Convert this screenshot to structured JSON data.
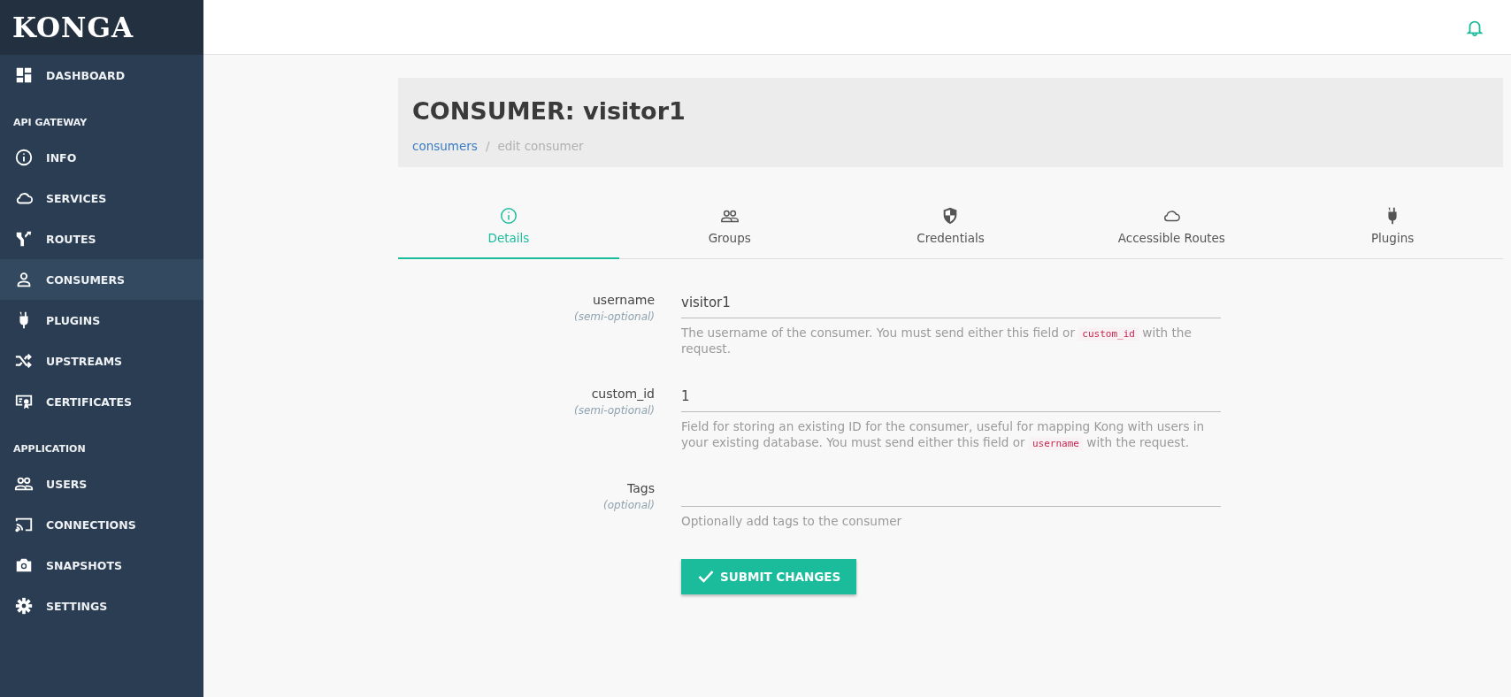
{
  "sidebar": {
    "logo": "KONGA",
    "items": [
      {
        "kind": "item",
        "label": "DASHBOARD",
        "selected": false
      },
      {
        "kind": "section",
        "label": "API GATEWAY"
      },
      {
        "kind": "item",
        "label": "INFO",
        "selected": false
      },
      {
        "kind": "item",
        "label": "SERVICES",
        "selected": false
      },
      {
        "kind": "item",
        "label": "ROUTES",
        "selected": false
      },
      {
        "kind": "item",
        "label": "CONSUMERS",
        "selected": true
      },
      {
        "kind": "item",
        "label": "PLUGINS",
        "selected": false
      },
      {
        "kind": "item",
        "label": "UPSTREAMS",
        "selected": false
      },
      {
        "kind": "item",
        "label": "CERTIFICATES",
        "selected": false
      },
      {
        "kind": "section",
        "label": "APPLICATION"
      },
      {
        "kind": "item",
        "label": "USERS",
        "selected": false
      },
      {
        "kind": "item",
        "label": "CONNECTIONS",
        "selected": false
      },
      {
        "kind": "item",
        "label": "SNAPSHOTS",
        "selected": false
      },
      {
        "kind": "item",
        "label": "SETTINGS",
        "selected": false
      }
    ]
  },
  "page": {
    "title": "CONSUMER: visitor1",
    "breadcrumb": [
      {
        "label": "consumers",
        "kind": "link"
      },
      {
        "label": "/",
        "kind": "separator"
      },
      {
        "label": "edit consumer",
        "kind": "current"
      }
    ]
  },
  "tabs": [
    {
      "label": "Details",
      "selected": true
    },
    {
      "label": "Groups",
      "selected": false
    },
    {
      "label": "Credentials",
      "selected": false
    },
    {
      "label": "Accessible Routes",
      "selected": false
    },
    {
      "label": "Plugins",
      "selected": false
    }
  ],
  "form": {
    "fields": [
      {
        "label": "username",
        "note": "(semi-optional)",
        "value": "visitor1",
        "help": [
          {
            "kind": "text",
            "text": "The username of the consumer. You must send either this field or "
          },
          {
            "kind": "code",
            "text": "custom_id"
          },
          {
            "kind": "text",
            "text": " with the request."
          }
        ]
      },
      {
        "label": "custom_id",
        "note": "(semi-optional)",
        "value": "1",
        "help": [
          {
            "kind": "text",
            "text": "Field for storing an existing ID for the consumer, useful for mapping Kong with users in your existing database. You must send either this field or "
          },
          {
            "kind": "code",
            "text": "username"
          },
          {
            "kind": "text",
            "text": " with the request."
          }
        ]
      },
      {
        "label": "Tags",
        "note": "(optional)",
        "help": [
          {
            "kind": "text",
            "text": "Optionally add tags to the consumer"
          }
        ]
      }
    ],
    "submit": "SUBMIT CHANGES"
  }
}
